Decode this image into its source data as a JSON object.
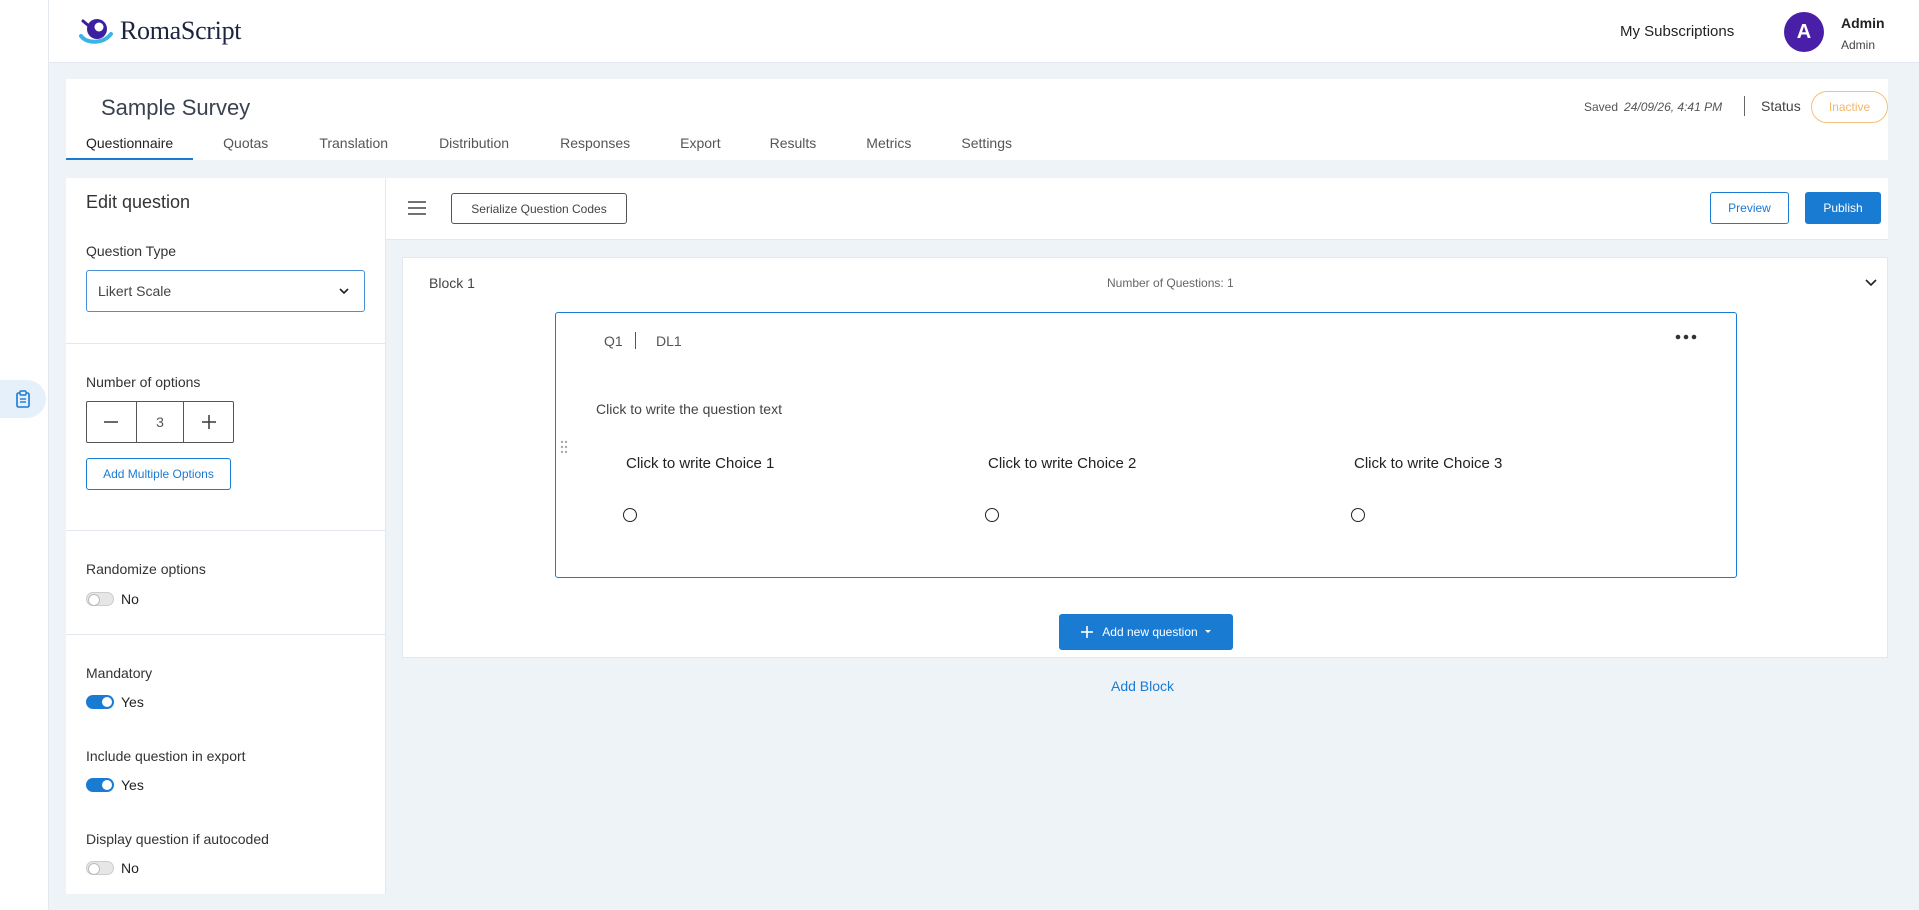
{
  "brand": {
    "logo_text": "RomaScript",
    "accent": "#1a7bd3",
    "avatar_color": "#4a1fa8"
  },
  "header": {
    "subscriptions_label": "My Subscriptions",
    "avatar_letter": "A",
    "user_name": "Admin",
    "user_role": "Admin"
  },
  "survey": {
    "title": "Sample Survey",
    "saved_label": "Saved",
    "saved_time": "24/09/26, 4:41 PM",
    "status_label": "Status",
    "status_value": "Inactive"
  },
  "tabs": [
    {
      "label": "Questionnaire",
      "active": true
    },
    {
      "label": "Quotas"
    },
    {
      "label": "Translation"
    },
    {
      "label": "Distribution"
    },
    {
      "label": "Responses"
    },
    {
      "label": "Export"
    },
    {
      "label": "Results"
    },
    {
      "label": "Metrics"
    },
    {
      "label": "Settings"
    }
  ],
  "edit_panel": {
    "title": "Edit question",
    "question_type_label": "Question Type",
    "question_type_value": "Likert Scale",
    "num_options_label": "Number of options",
    "num_options_value": "3",
    "add_multiple_label": "Add Multiple Options",
    "randomize_label": "Randomize options",
    "randomize_value": "No",
    "mandatory_label": "Mandatory",
    "mandatory_value": "Yes",
    "include_export_label": "Include question in export",
    "include_export_value": "Yes",
    "display_autocoded_label": "Display question if autocoded",
    "display_autocoded_value": "No"
  },
  "toolbar": {
    "serialize_label": "Serialize Question Codes",
    "preview_label": "Preview",
    "publish_label": "Publish"
  },
  "block": {
    "title": "Block 1",
    "count_label": "Number of Questions: 1",
    "question": {
      "code": "Q1",
      "dl": "DL1",
      "text_placeholder": "Click to write the question text",
      "choices": [
        "Click to write Choice 1",
        "Click to write Choice 2",
        "Click to write Choice 3"
      ]
    },
    "add_question_label": "Add new question"
  },
  "add_block_label": "Add Block",
  "icons": [
    "clipboard-icon",
    "chevron-down-icon",
    "minus-icon",
    "plus-icon",
    "hamburger-icon",
    "more-horizontal-icon",
    "drag-handle-icon",
    "caret-down-icon"
  ]
}
